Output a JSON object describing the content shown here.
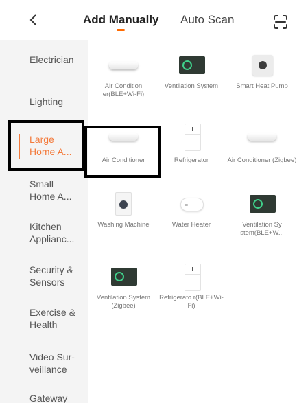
{
  "header": {
    "tabs": [
      {
        "label": "Add Manually",
        "active": true
      },
      {
        "label": "Auto Scan",
        "active": false
      }
    ],
    "back_icon": "chevron-left-icon",
    "scan_icon": "scan-frame-icon",
    "accent_color": "#ff6a00"
  },
  "sidebar": {
    "active_index": 2,
    "items": [
      {
        "label": "Electrician"
      },
      {
        "label": "Lighting"
      },
      {
        "label": "Large Home A..."
      },
      {
        "label": "Small Home A..."
      },
      {
        "label": "Kitchen Applianc..."
      },
      {
        "label": "Security & Sensors"
      },
      {
        "label": "Exercise & Health"
      },
      {
        "label": "Video Sur-veillance"
      },
      {
        "label": "Gateway"
      }
    ]
  },
  "devices": [
    {
      "label": "Air Condition er(BLE+Wi-Fi)",
      "icon": "air-conditioner-icon"
    },
    {
      "label": "Ventilation System",
      "icon": "ventilation-icon"
    },
    {
      "label": "Smart Heat Pump",
      "icon": "heat-pump-icon"
    },
    {
      "label": "Air Conditioner",
      "icon": "air-conditioner-icon"
    },
    {
      "label": "Refrigerator",
      "icon": "refrigerator-icon"
    },
    {
      "label": "Air Conditioner (Zigbee)",
      "icon": "air-conditioner-icon"
    },
    {
      "label": "Washing Machine",
      "icon": "washing-machine-icon"
    },
    {
      "label": "Water Heater",
      "icon": "water-heater-icon"
    },
    {
      "label": "Ventilation Sy stem(BLE+W...",
      "icon": "ventilation-icon"
    },
    {
      "label": "Ventilation System (Zigbee)",
      "icon": "ventilation-icon"
    },
    {
      "label": "Refrigerato r(BLE+Wi-Fi)",
      "icon": "refrigerator-icon"
    }
  ]
}
